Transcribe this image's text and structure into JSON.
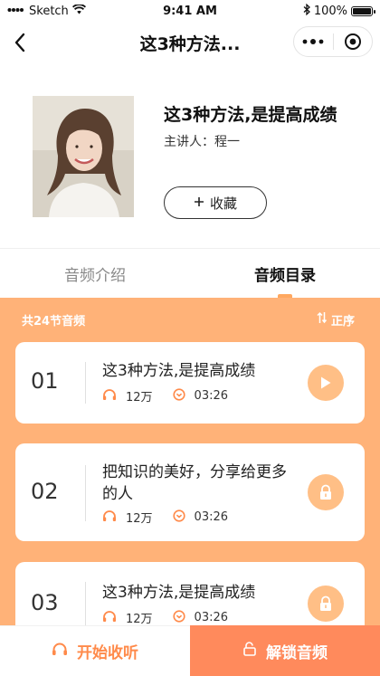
{
  "status_bar": {
    "carrier": "Sketch",
    "time": "9:41 AM",
    "battery": "100%",
    "battery_level": 1.0
  },
  "nav": {
    "title": "这3种方法..."
  },
  "course": {
    "title": "这3种方法,是提高成绩",
    "lecturer": "主讲人：程一",
    "favorite_label": "收藏",
    "favorite_icon": "plus-icon"
  },
  "tabs": [
    {
      "label": "音频介绍",
      "active": false
    },
    {
      "label": "音频目录",
      "active": true
    }
  ],
  "list": {
    "count_label": "共24节音频",
    "sort_label": "正序",
    "items": [
      {
        "num": "01",
        "title": "这3种方法,是提高成绩",
        "plays": "12万",
        "duration": "03:26",
        "action": "play-icon"
      },
      {
        "num": "02",
        "title": "把知识的美好，分享给更多的人",
        "plays": "12万",
        "duration": "03:26",
        "action": "lock-icon"
      },
      {
        "num": "03",
        "title": "这3种方法,是提高成绩",
        "plays": "12万",
        "duration": "03:26",
        "action": "lock-icon"
      }
    ]
  },
  "bottom_bar": {
    "listen_label": "开始收听",
    "unlock_label": "解锁音频"
  },
  "colors": {
    "accent": "#ff8a5c",
    "list_background": "#ffb278",
    "icon_orange": "#ff8a4a"
  }
}
